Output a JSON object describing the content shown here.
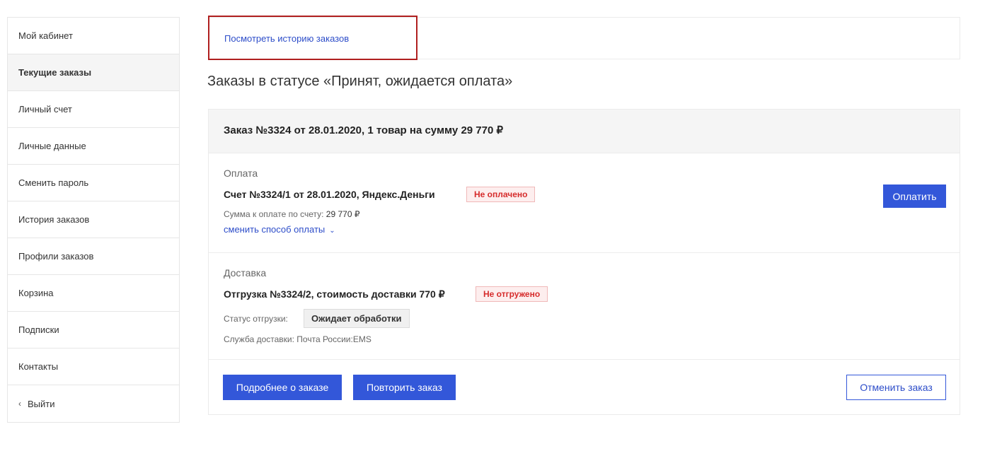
{
  "sidebar": {
    "items": [
      {
        "label": "Мой кабинет"
      },
      {
        "label": "Текущие заказы",
        "active": true
      },
      {
        "label": "Личный счет"
      },
      {
        "label": "Личные данные"
      },
      {
        "label": "Сменить пароль"
      },
      {
        "label": "История заказов"
      },
      {
        "label": "Профили заказов"
      },
      {
        "label": "Корзина"
      },
      {
        "label": "Подписки"
      },
      {
        "label": "Контакты"
      }
    ],
    "logout": {
      "icon": "chevron-left-icon",
      "label": "Выйти"
    }
  },
  "history_link": "Посмотреть историю заказов",
  "status_heading": "Заказы в статусе «Принят, ожидается оплата»",
  "order": {
    "title": "Заказ №3324 от 28.01.2020, 1 товар на сумму 29 770 ₽",
    "payment": {
      "section_label": "Оплата",
      "invoice_title": "Счет №3324/1 от 28.01.2020, Яндекс.Деньги",
      "status_badge": "Не оплачено",
      "amount_label": "Сумма к оплате по счету:",
      "amount_value": "29 770 ₽",
      "change_method": "сменить способ оплаты",
      "pay_button": "Оплатить"
    },
    "delivery": {
      "section_label": "Доставка",
      "shipment_title": "Отгрузка №3324/2, стоимость доставки 770 ₽",
      "status_badge": "Не отгружено",
      "shipment_status_label": "Статус отгрузки:",
      "shipment_status_value": "Ожидает обработки",
      "service_label": "Служба доставки:",
      "service_value": "Почта России:EMS"
    },
    "actions": {
      "details": "Подробнее о заказе",
      "repeat": "Повторить заказ",
      "cancel": "Отменить заказ"
    }
  },
  "colors": {
    "accent": "#3357d9",
    "link": "#2d4dc9",
    "badge_red": "#d62b2b",
    "highlight_border": "#b01f1f"
  }
}
